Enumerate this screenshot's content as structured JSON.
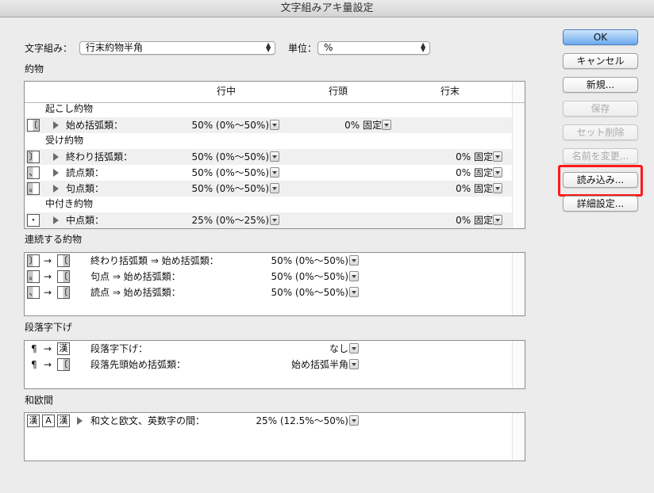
{
  "window": {
    "title": "文字組みアキ量設定"
  },
  "top": {
    "mojigumi_label": "文字組み：",
    "mojigumi_value": "行末約物半角",
    "unit_label": "単位：",
    "unit_value": "%"
  },
  "yakumono": {
    "section_label": "約物",
    "columns": [
      "行中",
      "行頭",
      "行末"
    ],
    "groups": [
      {
        "label": "起こし約物"
      },
      {
        "label": "受け約物"
      },
      {
        "label": "中付き約物"
      }
    ],
    "rows": [
      {
        "label": "始め括弧類：",
        "mid": "50% (0%〜50%)",
        "head": "0% 固定",
        "tail": ""
      },
      {
        "label": "終わり括弧類：",
        "mid": "50% (0%〜50%)",
        "head": "",
        "tail": "0% 固定"
      },
      {
        "label": "読点類：",
        "mid": "50% (0%〜50%)",
        "head": "",
        "tail": "0% 固定"
      },
      {
        "label": "句点類：",
        "mid": "50% (0%〜50%)",
        "head": "",
        "tail": "0% 固定"
      },
      {
        "label": "中点類：",
        "mid": "25% (0%〜25%)",
        "head": "",
        "tail": "0% 固定"
      }
    ]
  },
  "renzoku": {
    "section_label": "連続する約物",
    "rows": [
      {
        "label": "終わり括弧類 ⇒ 始め括弧類：",
        "value": "50% (0%〜50%)"
      },
      {
        "label": "句点 ⇒ 始め括弧類：",
        "value": "50% (0%〜50%)"
      },
      {
        "label": "読点 ⇒ 始め括弧類：",
        "value": "50% (0%〜50%)"
      }
    ]
  },
  "dansaku": {
    "section_label": "段落字下げ",
    "rows": [
      {
        "label": "段落字下げ：",
        "value": "なし"
      },
      {
        "label": "段落先頭始め括弧類：",
        "value": "始め括弧半角"
      }
    ]
  },
  "wao": {
    "section_label": "和欧間",
    "rows": [
      {
        "label": "和文と欧文、英数字の間：",
        "value": "25% (12.5%〜50%)"
      }
    ]
  },
  "buttons": {
    "ok": "OK",
    "cancel": "キャンセル",
    "new": "新規...",
    "save": "保存",
    "delete": "セット削除",
    "rename": "名前を変更...",
    "load": "読み込み...",
    "detail": "詳細設定..."
  },
  "icons": {
    "open_bracket": "〔",
    "close_bracket": "〕",
    "comma": "、",
    "period": "。",
    "middle_dot": "・",
    "arrow": "→",
    "pilcrow": "¶",
    "kanji_sample": "漢",
    "alpha_sample": "A"
  },
  "colors": {
    "highlight": "#ff1a1a",
    "primary_button": "#6aa9ee"
  }
}
